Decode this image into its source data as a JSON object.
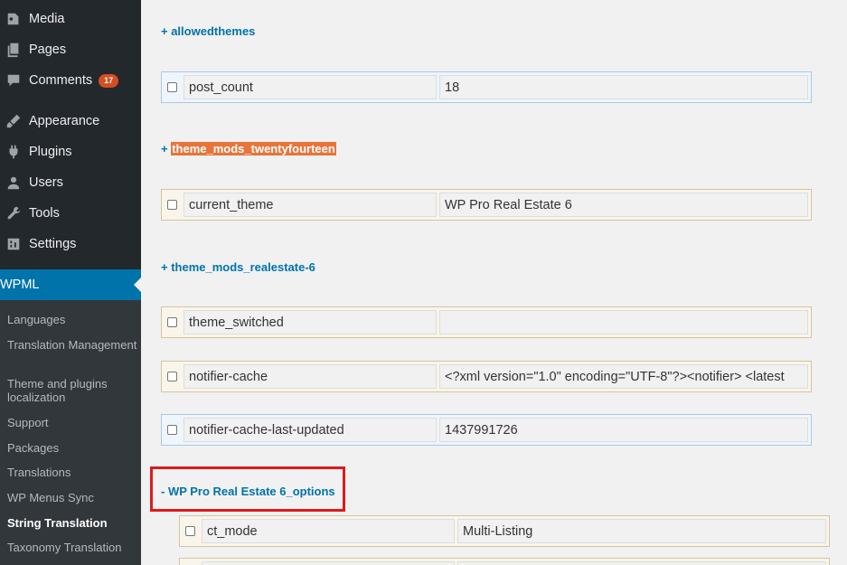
{
  "sidebar": {
    "menu": [
      {
        "label": "Media",
        "icon": "media-icon"
      },
      {
        "label": "Pages",
        "icon": "pages-icon"
      },
      {
        "label": "Comments",
        "icon": "comments-icon",
        "badge": "17"
      },
      {
        "label": "Appearance",
        "icon": "appearance-icon"
      },
      {
        "label": "Plugins",
        "icon": "plugins-icon"
      },
      {
        "label": "Users",
        "icon": "users-icon"
      },
      {
        "label": "Tools",
        "icon": "tools-icon"
      },
      {
        "label": "Settings",
        "icon": "settings-icon"
      }
    ],
    "active": {
      "label": "WPML",
      "icon": "wpml-icon"
    },
    "submenu": [
      "Languages",
      "Translation Management",
      "Theme and plugins localization",
      "Support",
      "Packages",
      "Translations",
      "WP Menus Sync",
      "String Translation",
      "Taxonomy Translation"
    ],
    "active_submenu": "String Translation"
  },
  "content": {
    "groups": [
      {
        "label": "+ allowedthemes"
      },
      {
        "prefix": "+ ",
        "label": "theme_mods_twentyfourteen",
        "highlighted": true
      },
      {
        "label": "+ theme_mods_realestate-6"
      },
      {
        "label": "- WP Pro Real Estate 6_options"
      }
    ],
    "rows": [
      {
        "key": "post_count",
        "value": "18",
        "style": "blue"
      },
      {
        "key": "current_theme",
        "value": "WP Pro Real Estate 6",
        "style": "tan"
      },
      {
        "key": "theme_switched",
        "value": "",
        "style": "tan"
      },
      {
        "key": "notifier-cache",
        "value": "<?xml version=\"1.0\" encoding=\"UTF-8\"?><notifier>    <latest",
        "style": "tan"
      },
      {
        "key": "notifier-cache-last-updated",
        "value": "1437991726",
        "style": "blue"
      },
      {
        "key": "ct_mode",
        "value": "Multi-Listing",
        "style": "tan"
      },
      {
        "key": "",
        "value": "",
        "style": "tan"
      }
    ]
  },
  "colors": {
    "sidebar_bg": "#23282d",
    "active_bg": "#0073aa",
    "link": "#0073aa",
    "highlight": "#e8743b",
    "badge": "#d54e21",
    "annotation_box": "#e0191c"
  }
}
